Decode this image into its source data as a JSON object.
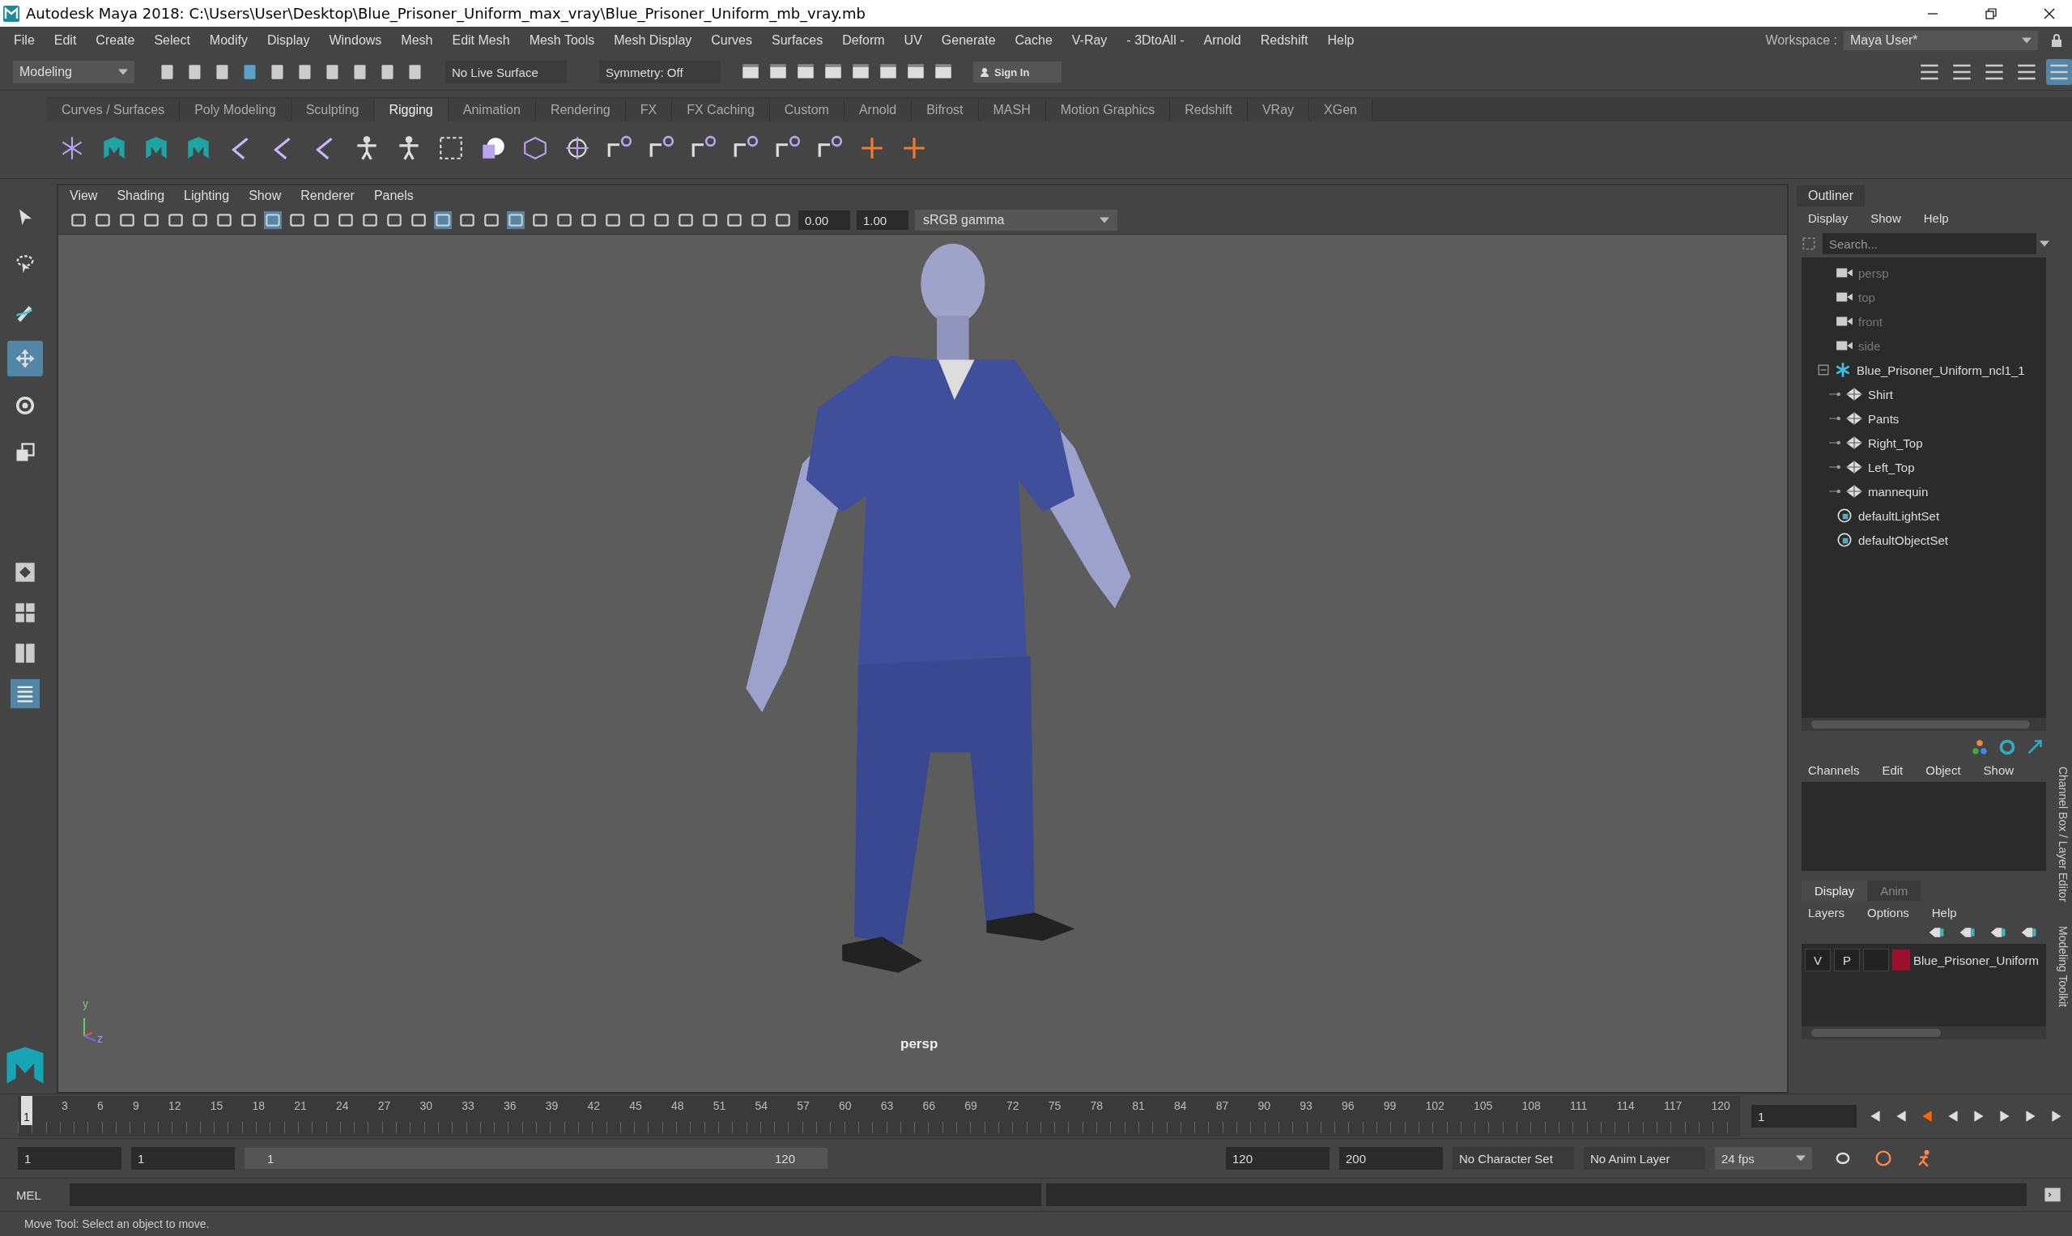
{
  "window": {
    "title": "Autodesk Maya 2018: C:\\Users\\User\\Desktop\\Blue_Prisoner_Uniform_max_vray\\Blue_Prisoner_Uniform_mb_vray.mb"
  },
  "menu_bar": [
    "File",
    "Edit",
    "Create",
    "Select",
    "Modify",
    "Display",
    "Windows",
    "Mesh",
    "Edit Mesh",
    "Mesh Tools",
    "Mesh Display",
    "Curves",
    "Surfaces",
    "Deform",
    "UV",
    "Generate",
    "Cache",
    "V-Ray",
    "- 3DtoAll -",
    "Arnold",
    "Redshift",
    "Help"
  ],
  "workspace": {
    "label": "Workspace :",
    "value": "Maya User*"
  },
  "status_line": {
    "mode": "Modeling",
    "live_surface": "No Live Surface",
    "symmetry": "Symmetry: Off",
    "sign_in": "Sign In"
  },
  "shelf_tabs": [
    {
      "label": "Curves / Surfaces",
      "selected": false
    },
    {
      "label": "Poly Modeling",
      "selected": false
    },
    {
      "label": "Sculpting",
      "selected": false
    },
    {
      "label": "Rigging",
      "selected": true
    },
    {
      "label": "Animation",
      "selected": false
    },
    {
      "label": "Rendering",
      "selected": false
    },
    {
      "label": "FX",
      "selected": false
    },
    {
      "label": "FX Caching",
      "selected": false
    },
    {
      "label": "Custom",
      "selected": false
    },
    {
      "label": "Arnold",
      "selected": false
    },
    {
      "label": "Bifrost",
      "selected": false
    },
    {
      "label": "MASH",
      "selected": false
    },
    {
      "label": "Motion Graphics",
      "selected": false
    },
    {
      "label": "Redshift",
      "selected": false
    },
    {
      "label": "VRay",
      "selected": false
    },
    {
      "label": "XGen",
      "selected": false
    }
  ],
  "toolbox": [
    {
      "kind": "select",
      "selected": false
    },
    {
      "kind": "lasso",
      "selected": false
    },
    {
      "kind": "paint",
      "selected": false
    },
    {
      "kind": "move",
      "selected": true
    },
    {
      "kind": "rotate",
      "selected": false
    },
    {
      "kind": "scale",
      "selected": false
    }
  ],
  "viewport": {
    "menus": [
      "View",
      "Shading",
      "Lighting",
      "Show",
      "Renderer",
      "Panels"
    ],
    "exposure": "0.00",
    "gamma": "1.00",
    "color_space": "sRGB gamma",
    "camera_label": "persp",
    "axis_labels": [
      "y",
      "z"
    ]
  },
  "outliner": {
    "title": "Outliner",
    "menus": [
      "Display",
      "Show",
      "Help"
    ],
    "search_placeholder": "Search...",
    "items": [
      {
        "label": "persp",
        "kind": "camera",
        "dimmed": true
      },
      {
        "label": "top",
        "kind": "camera",
        "dimmed": true
      },
      {
        "label": "front",
        "kind": "camera",
        "dimmed": true
      },
      {
        "label": "side",
        "kind": "camera",
        "dimmed": true
      },
      {
        "label": "Blue_Prisoner_Uniform_ncl1_1",
        "kind": "group",
        "dimmed": false,
        "expanded": true,
        "children": [
          {
            "label": "Shirt",
            "kind": "mesh",
            "dimmed": false
          },
          {
            "label": "Pants",
            "kind": "mesh",
            "dimmed": false
          },
          {
            "label": "Right_Top",
            "kind": "mesh",
            "dimmed": false
          },
          {
            "label": "Left_Top",
            "kind": "mesh",
            "dimmed": false
          },
          {
            "label": "mannequin",
            "kind": "mesh",
            "dimmed": false
          }
        ]
      },
      {
        "label": "defaultLightSet",
        "kind": "set",
        "dimmed": false
      },
      {
        "label": "defaultObjectSet",
        "kind": "set",
        "dimmed": false
      }
    ]
  },
  "channel_box": {
    "menus": [
      "Channels",
      "Edit",
      "Object",
      "Show"
    ]
  },
  "side_tabs": [
    "Channel Box / Layer Editor",
    "Modeling Toolkit"
  ],
  "layer_editor": {
    "tabs": [
      {
        "label": "Display",
        "selected": true
      },
      {
        "label": "Anim",
        "selected": false
      }
    ],
    "menus": [
      "Layers",
      "Options",
      "Help"
    ],
    "layers": [
      {
        "visible": "V",
        "playback": "P",
        "color": "#9e0f2d",
        "name": "Blue_Prisoner_Uniform"
      }
    ]
  },
  "timeline": {
    "start_frame": "1",
    "ticks": [
      "3",
      "6",
      "9",
      "12",
      "15",
      "18",
      "21",
      "24",
      "27",
      "30",
      "33",
      "36",
      "39",
      "42",
      "45",
      "48",
      "51",
      "54",
      "57",
      "60",
      "63",
      "66",
      "69",
      "72",
      "75",
      "78",
      "81",
      "84",
      "87",
      "90",
      "93",
      "96",
      "99",
      "102",
      "105",
      "108",
      "111",
      "114",
      "117",
      "120"
    ],
    "current_frame": "1"
  },
  "range": {
    "start": "1",
    "playback_start": "1",
    "slider_start": "1",
    "slider_end": "120",
    "playback_end": "120",
    "end": "200",
    "character_set": "No Character Set",
    "anim_layer": "No Anim Layer",
    "fps": "24 fps"
  },
  "command_line": {
    "label": "MEL"
  },
  "help_line": "Move Tool: Select an object to move."
}
